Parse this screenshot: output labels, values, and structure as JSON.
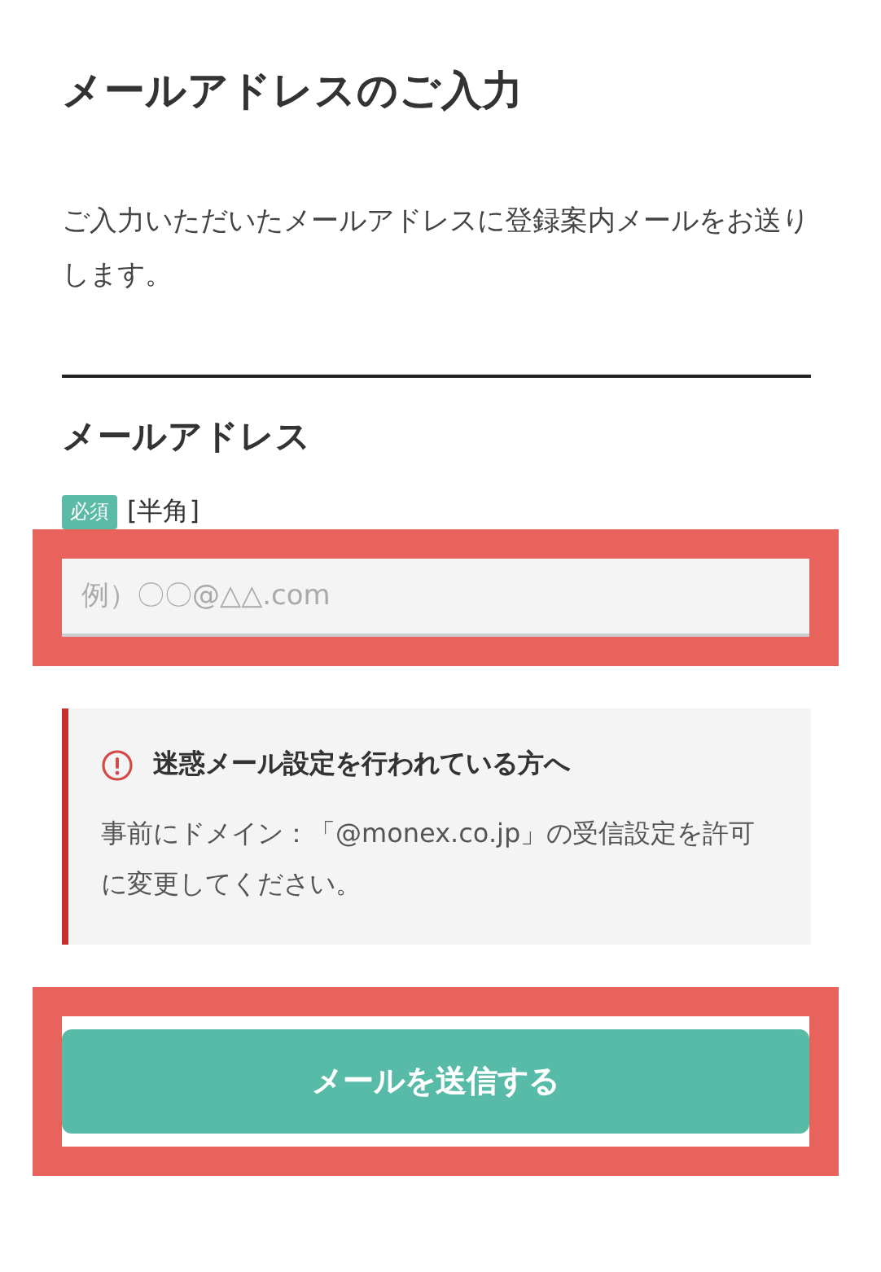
{
  "title": "メールアドレスのご入力",
  "intro": "ご入力いただいたメールアドレスに登録案内メールをお送りします。",
  "field": {
    "label": "メールアドレス",
    "required_badge": "必須",
    "note": "[半角]",
    "placeholder": "例）〇〇@△△.com",
    "highlighted": true
  },
  "notice": {
    "heading": "迷惑メール設定を行われている方へ",
    "body": "事前にドメイン：「@monex.co.jp」の受信設定を許可に変更してください。"
  },
  "submit": {
    "label": "メールを送信する",
    "highlighted": true
  }
}
